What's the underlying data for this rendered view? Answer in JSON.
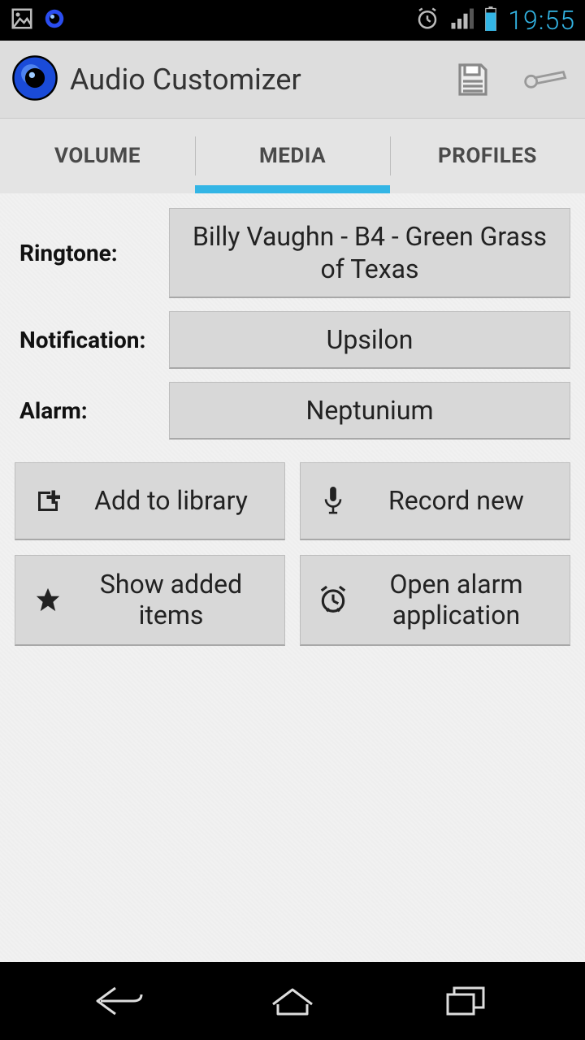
{
  "status": {
    "time": "19:55"
  },
  "header": {
    "title": "Audio Customizer"
  },
  "tabs": [
    {
      "label": "VOLUME",
      "active": false
    },
    {
      "label": "MEDIA",
      "active": true
    },
    {
      "label": "PROFILES",
      "active": false
    }
  ],
  "media": {
    "ringtone_label": "Ringtone:",
    "ringtone_value": "Billy Vaughn - B4 - Green Grass of Texas",
    "notification_label": "Notification:",
    "notification_value": "Upsilon",
    "alarm_label": "Alarm:",
    "alarm_value": "Neptunium"
  },
  "buttons": {
    "add_library": "Add to library",
    "record_new": "Record new",
    "show_added": "Show added items",
    "open_alarm": "Open alarm application"
  }
}
